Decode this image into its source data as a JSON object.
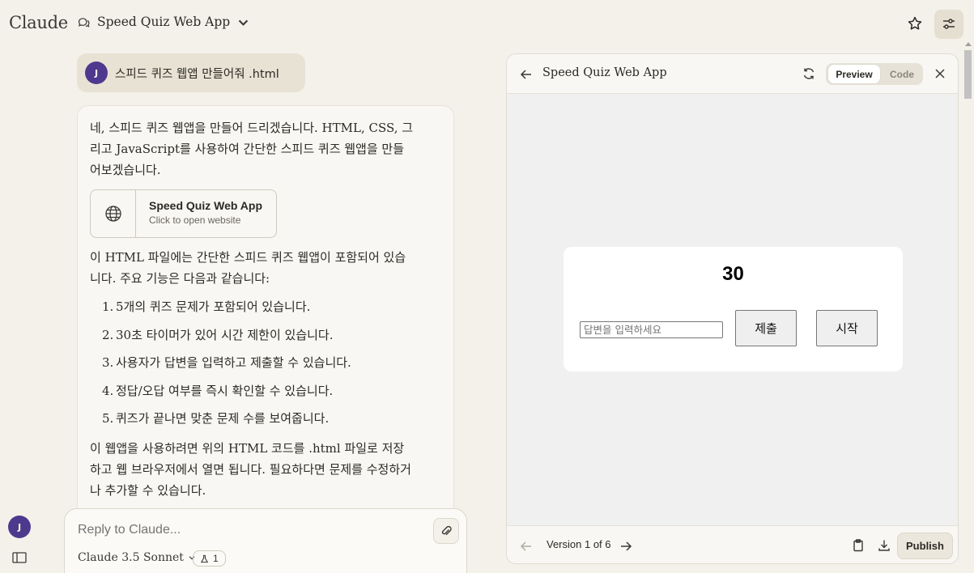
{
  "app": {
    "brand": "Claude",
    "chat_title": "Speed Quiz Web App"
  },
  "user_message": {
    "avatar_initial": "J",
    "text": "스피드 퀴즈 웹앱 만들어줘 .html"
  },
  "assistant": {
    "intro": "네, 스피드 퀴즈 웹앱을 만들어 드리겠습니다. HTML, CSS, 그리고 JavaScript를 사용하여 간단한 스피드 퀴즈 웹앱을 만들어보겠습니다.",
    "artifact": {
      "title": "Speed Quiz Web App",
      "subtitle": "Click to open website",
      "icon": "globe-icon"
    },
    "features_intro": "이 HTML 파일에는 간단한 스피드 퀴즈 웹앱이 포함되어 있습니다. 주요 기능은 다음과 같습니다:",
    "features": [
      {
        "num": "1.",
        "text": "5개의 퀴즈 문제가 포함되어 있습니다."
      },
      {
        "num": "2.",
        "text": "30초 타이머가 있어 시간 제한이 있습니다."
      },
      {
        "num": "3.",
        "text": "사용자가 답변을 입력하고 제출할 수 있습니다."
      },
      {
        "num": "4.",
        "text": "정답/오답 여부를 즉시 확인할 수 있습니다."
      },
      {
        "num": "5.",
        "text": "퀴즈가 끝나면 맞춘 문제 수를 보여줍니다."
      }
    ],
    "outro": "이 웹앱을 사용하려면 위의 HTML 코드를 .html 파일로 저장하고 웹 브라우저에서 열면 됩니다. 필요하다면 문제를 수정하거나 추가할 수 있습니다."
  },
  "composer": {
    "placeholder": "Reply to Claude...",
    "model": "Claude 3.5 Sonnet",
    "badge_count": "1"
  },
  "sidebar": {
    "avatar_initial": "J"
  },
  "panel": {
    "title": "Speed Quiz Web App",
    "tabs": {
      "preview": "Preview",
      "code": "Code"
    },
    "active_tab": "Preview",
    "quiz": {
      "timer": "30",
      "answer_placeholder": "답변을 입력하세요",
      "submit_label": "제출",
      "start_label": "시작"
    },
    "footer": {
      "version": "Version 1 of 6",
      "publish_label": "Publish"
    }
  },
  "colors": {
    "background": "#f3f1ea",
    "avatar": "#4d3a8f",
    "panel_canvas": "#f0f0f0"
  }
}
